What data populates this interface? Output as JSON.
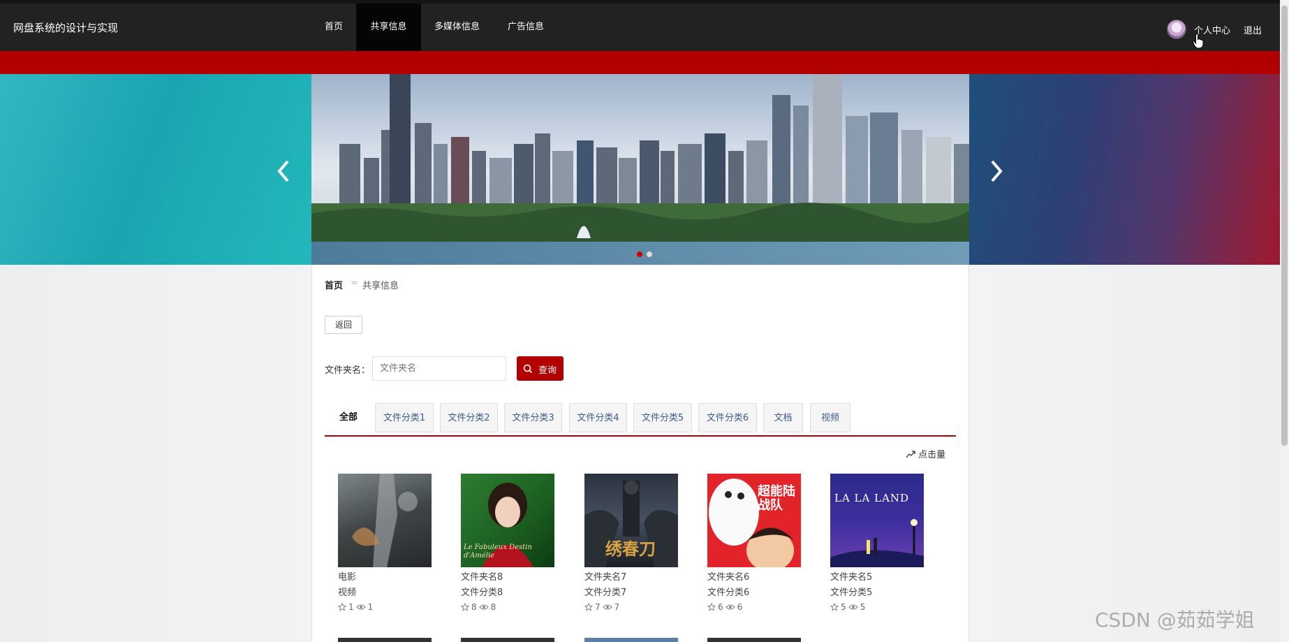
{
  "navbar": {
    "brand": "网盘系统的设计与实现",
    "items": [
      {
        "label": "首页"
      },
      {
        "label": "共享信息"
      },
      {
        "label": "多媒体信息"
      },
      {
        "label": "广告信息"
      }
    ],
    "profile_label": "个人中心",
    "logout_label": "退出"
  },
  "breadcrumb": {
    "home": "首页",
    "separator": "=",
    "current": "共享信息"
  },
  "back_label": "返回",
  "search": {
    "label": "文件夹名：",
    "placeholder": "文件夹名",
    "button_label": "查询"
  },
  "tabs": [
    {
      "label": "全部"
    },
    {
      "label": "文件分类1"
    },
    {
      "label": "文件分类2"
    },
    {
      "label": "文件分类3"
    },
    {
      "label": "文件分类4"
    },
    {
      "label": "文件分类5"
    },
    {
      "label": "文件分类6"
    },
    {
      "label": "文档"
    },
    {
      "label": "视频"
    }
  ],
  "sort_label": "点击量",
  "cards": [
    {
      "title": "电影",
      "category": "视频",
      "stars": "1",
      "views": "1"
    },
    {
      "title": "文件夹名8",
      "category": "文件分类8",
      "stars": "8",
      "views": "8"
    },
    {
      "title": "文件夹名7",
      "category": "文件分类7",
      "stars": "7",
      "views": "7"
    },
    {
      "title": "文件夹名6",
      "category": "文件分类6",
      "stars": "6",
      "views": "6"
    },
    {
      "title": "文件夹名5",
      "category": "文件分类5",
      "stars": "5",
      "views": "5"
    }
  ],
  "posters": {
    "p2_text": "Le Fabuleux Destin d'Amélie",
    "p3_text": "绣春刀",
    "p4_text": "超能陆战队",
    "p5_text": "LA LA LAND"
  },
  "watermark": "CSDN @茹茹学姐",
  "colors": {
    "accent": "#b20000",
    "nav_bg": "#222222"
  }
}
